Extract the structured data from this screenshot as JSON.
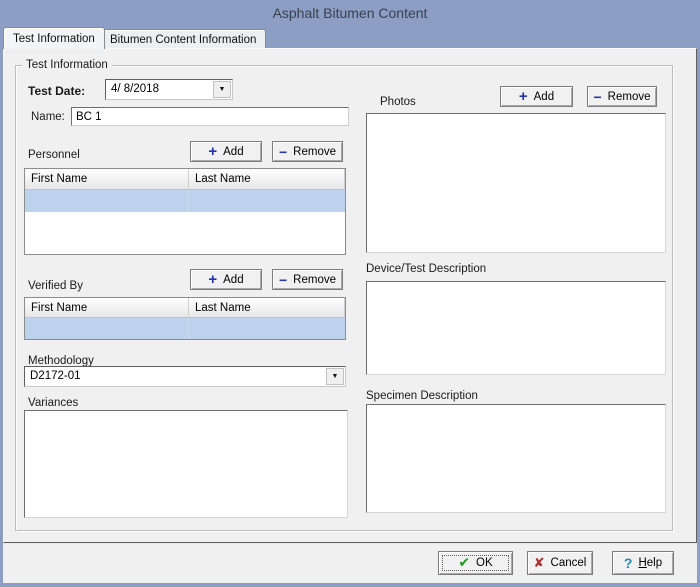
{
  "window": {
    "title": "Asphalt Bitumen Content"
  },
  "tabs": [
    {
      "label": "Test Information",
      "active": true
    },
    {
      "label": "Bitumen Content Information",
      "active": false
    }
  ],
  "group_title": "Test Information",
  "fields": {
    "test_date": {
      "label": "Test Date:",
      "value": "4/ 8/2018"
    },
    "name": {
      "label": "Name:",
      "value": "BC 1"
    },
    "methodology": {
      "label": "Methodology",
      "value": "D2172-01"
    },
    "variances": {
      "label": "Variances",
      "value": ""
    }
  },
  "personnel": {
    "label": "Personnel",
    "add_label": "Add",
    "remove_label": "Remove",
    "columns": [
      "First Name",
      "Last Name"
    ],
    "rows": [
      {
        "first_name": "",
        "last_name": "",
        "selected": true
      }
    ]
  },
  "verified_by": {
    "label": "Verified By",
    "add_label": "Add",
    "remove_label": "Remove",
    "columns": [
      "First Name",
      "Last Name"
    ],
    "rows": [
      {
        "first_name": "",
        "last_name": "",
        "selected": true
      }
    ]
  },
  "photos": {
    "label": "Photos",
    "add_label": "Add",
    "remove_label": "Remove",
    "items": []
  },
  "descriptions": {
    "device": {
      "label": "Device/Test Description",
      "value": ""
    },
    "specimen": {
      "label": "Specimen Description",
      "value": ""
    }
  },
  "footer": {
    "ok_label": "OK",
    "cancel_label": "Cancel",
    "help_key": "H",
    "help_rest": "elp"
  },
  "icons": {
    "add": "+",
    "remove": "−",
    "dropdown": "▼",
    "ok_check": "✔",
    "cancel_x": "✘",
    "help_question": "?"
  },
  "colors": {
    "titlebar-blue": "#8c9ec4",
    "selection-blue": "#bdd2ec",
    "accent-blue": "#2233b0",
    "ok-green": "#1e9c1e",
    "cancel-red": "#b22a2a",
    "help-teal": "#2787b7"
  }
}
